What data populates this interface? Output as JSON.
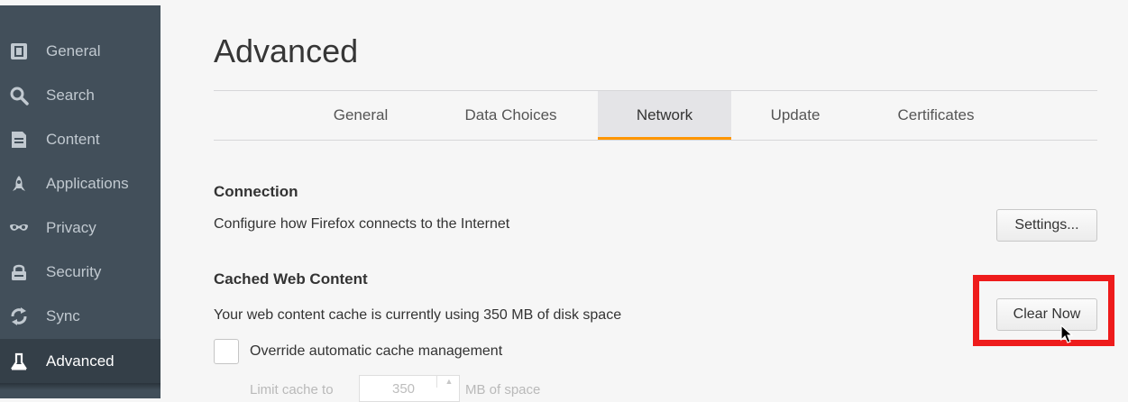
{
  "sidebar": {
    "items": [
      {
        "label": "General",
        "icon": "general-icon"
      },
      {
        "label": "Search",
        "icon": "search-icon"
      },
      {
        "label": "Content",
        "icon": "content-icon"
      },
      {
        "label": "Applications",
        "icon": "applications-icon"
      },
      {
        "label": "Privacy",
        "icon": "privacy-mask-icon"
      },
      {
        "label": "Security",
        "icon": "security-lock-icon"
      },
      {
        "label": "Sync",
        "icon": "sync-icon"
      },
      {
        "label": "Advanced",
        "icon": "advanced-icon"
      }
    ],
    "active": "Advanced"
  },
  "page": {
    "title": "Advanced"
  },
  "tabs": [
    {
      "label": "General"
    },
    {
      "label": "Data Choices"
    },
    {
      "label": "Network"
    },
    {
      "label": "Update"
    },
    {
      "label": "Certificates"
    }
  ],
  "active_tab": "Network",
  "connection": {
    "heading": "Connection",
    "description": "Configure how Firefox connects to the Internet",
    "button_label": "Settings..."
  },
  "cache": {
    "heading": "Cached Web Content",
    "description": "Your web content cache is currently using 350 MB of disk space",
    "button_label": "Clear Now",
    "override_label": "Override automatic cache management",
    "override_checked": false,
    "limit_prefix": "Limit cache to",
    "limit_value": "350",
    "limit_suffix": "MB of space"
  },
  "colors": {
    "sidebar_bg": "#424f5a",
    "active_tab_accent": "#ff9500",
    "highlight_box": "#ee1c1c"
  }
}
